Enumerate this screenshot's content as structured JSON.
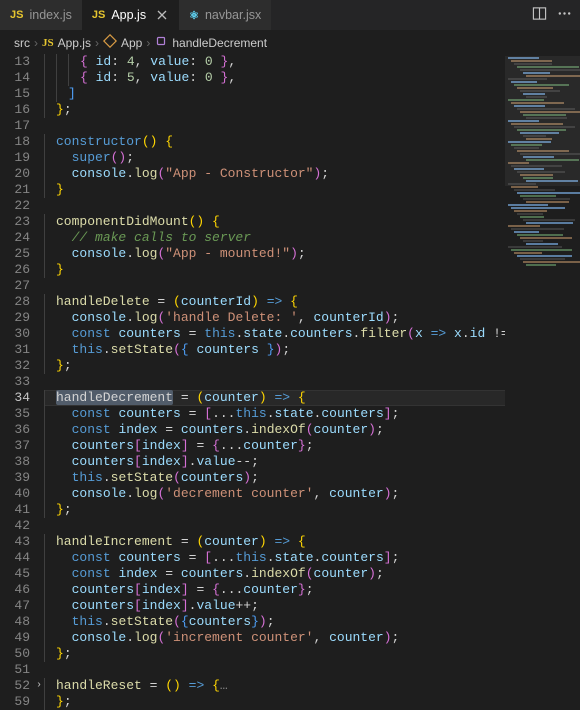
{
  "tabs": [
    {
      "icon": "JS",
      "label": "index.js",
      "active": false
    },
    {
      "icon": "JS",
      "label": "App.js",
      "active": true,
      "closeable": true
    },
    {
      "icon": "⚛",
      "label": "navbar.jsx",
      "active": false
    }
  ],
  "breadcrumb": {
    "root": "src",
    "icon1": "JS",
    "file": "App.js",
    "sym_class": "App",
    "sym_method": "handleDecrement"
  },
  "lines": {
    "start": 13,
    "end": 59,
    "current": 34,
    "folded": 52
  },
  "code": {
    "l13": "        { id: 4, value: 0 },",
    "l14": "        { id: 5, value: 0 },",
    "l15": "      ]",
    "l16": "    };",
    "l17": "",
    "l18_a": "    constructor",
    "l18_b": "() {",
    "l19": "      super();",
    "l20_a": "      console",
    "l20_b": ".log(",
    "l20_c": "\"App - Constructor\"",
    "l20_d": ");",
    "l21": "    }",
    "l22": "",
    "l23_a": "    componentDidMount",
    "l23_b": "() {",
    "l24": "      // make calls to server",
    "l25_a": "      console",
    "l25_b": ".log(",
    "l25_c": "\"App - mounted!\"",
    "l25_d": ");",
    "l26": "    }",
    "l27": "",
    "l28_a": "    handleDelete",
    "l28_b": " = (",
    "l28_c": "counterId",
    "l28_d": ") => {",
    "l29_a": "      console",
    "l29_b": ".log(",
    "l29_c": "'handle Delete: '",
    "l29_d": ", counterId);",
    "l30_a": "      const",
    "l30_b": " counters",
    "l30_c": " = ",
    "l30_d": "this",
    "l30_e": ".state.counters.",
    "l30_f": "filter",
    "l30_g": "(",
    "l30_h": "x",
    "l30_i": " => ",
    "l30_j": "x.id !== coun",
    "l31_a": "      this",
    "l31_b": ".setState({ counters });",
    "l32": "    };",
    "l33": "",
    "l34_a": "    ",
    "l34_sel": "handleDecrement",
    "l34_b": " = (",
    "l34_c": "counter",
    "l34_d": ") => {",
    "l35_a": "      const",
    "l35_b": " counters",
    "l35_c": " = [...",
    "l35_d": "this",
    "l35_e": ".state.counters];",
    "l36_a": "      const",
    "l36_b": " index",
    "l36_c": " = counters.",
    "l36_d": "indexOf",
    "l36_e": "(counter);",
    "l37_a": "      counters[index] = {...counter};",
    "l38": "      counters[index].value--;",
    "l39_a": "      this",
    "l39_b": ".setState(counters);",
    "l40_a": "      console",
    "l40_b": ".log(",
    "l40_c": "'decrement counter'",
    "l40_d": ", counter);",
    "l41": "    };",
    "l42": "",
    "l43_a": "    handleIncrement",
    "l43_b": " = (",
    "l43_c": "counter",
    "l43_d": ") => {",
    "l44_a": "      const",
    "l44_b": " counters",
    "l44_c": " = [...",
    "l44_d": "this",
    "l44_e": ".state.counters];",
    "l45_a": "      const",
    "l45_b": " index",
    "l45_c": " = counters.",
    "l45_d": "indexOf",
    "l45_e": "(counter);",
    "l46": "      counters[index] = {...counter};",
    "l47": "      counters[index].value++;",
    "l48_a": "      this",
    "l48_b": ".setState({counters});",
    "l49_a": "      console",
    "l49_b": ".log(",
    "l49_c": "'increment counter'",
    "l49_d": ", counter);",
    "l50": "    };",
    "l51": "",
    "l52_a": "    handleReset",
    "l52_b": " = () => {",
    "l52_fold": "…",
    "l59": "    };"
  }
}
